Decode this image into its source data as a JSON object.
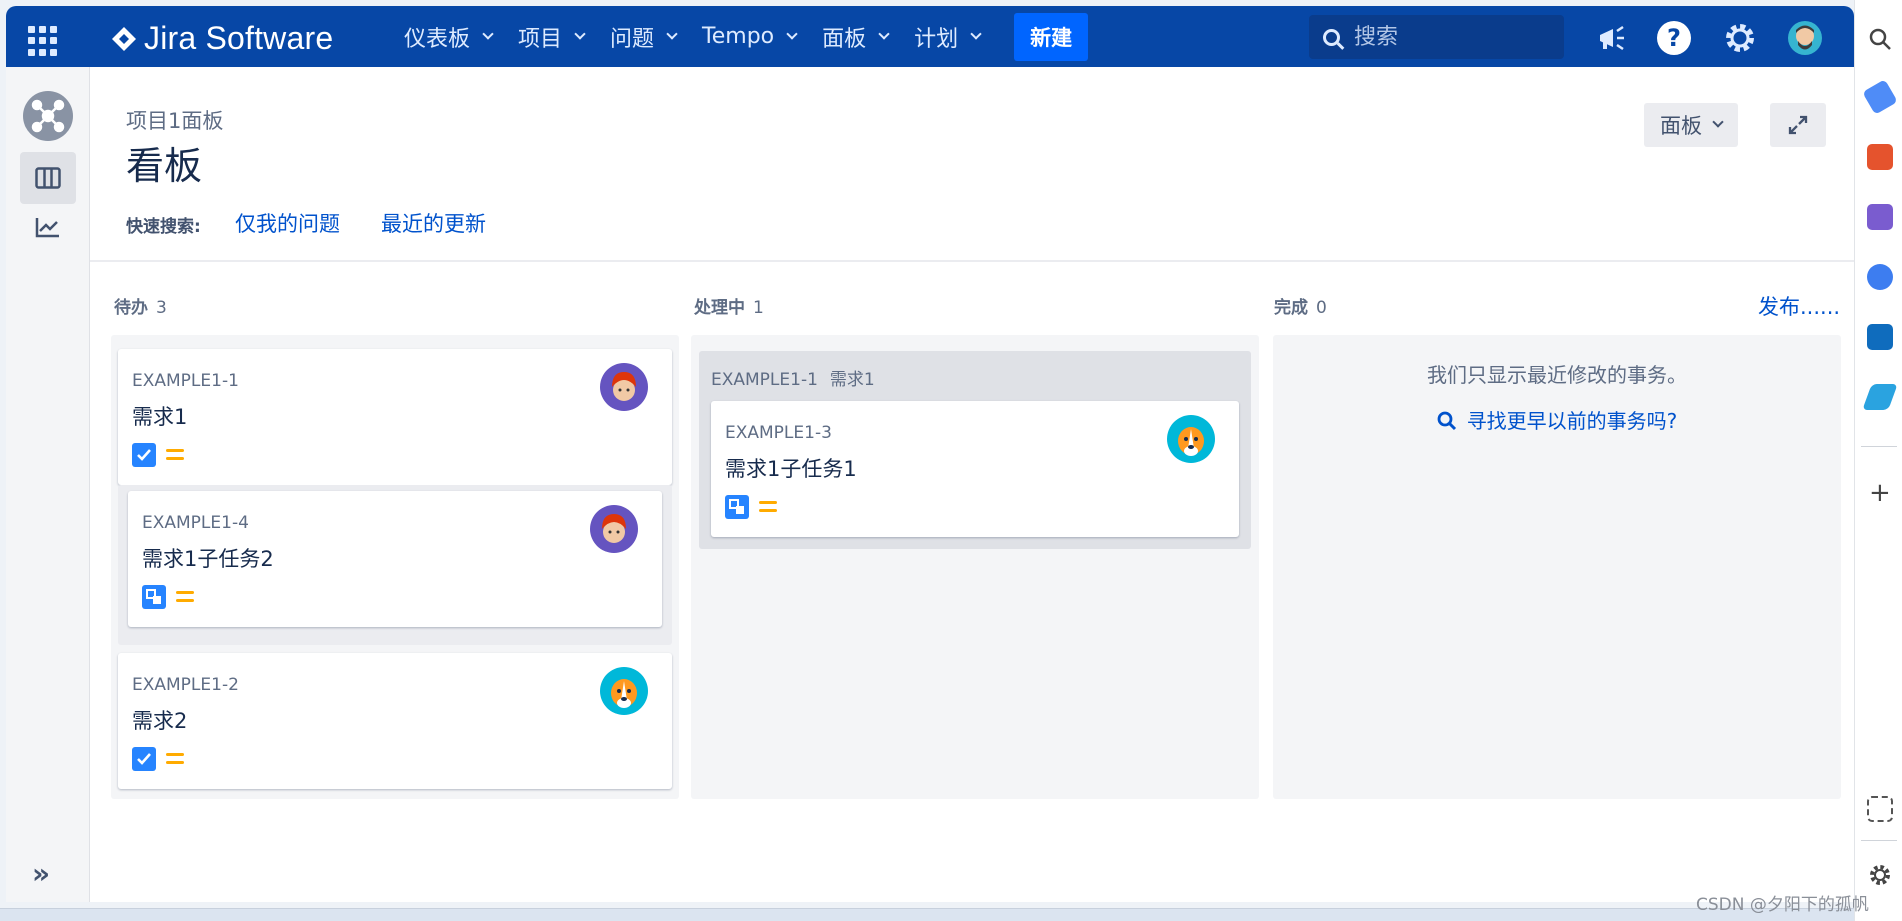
{
  "topnav": {
    "product_name": "Jira Software",
    "menu": [
      "仪表板",
      "项目",
      "问题",
      "Tempo",
      "面板",
      "计划"
    ],
    "create_label": "新建",
    "search_placeholder": "搜索",
    "help_label": "?"
  },
  "page": {
    "breadcrumb": "项目1面板",
    "title": "看板",
    "board_select_label": "面板",
    "quick_filters_label": "快速搜索:",
    "quick_filters": [
      "仅我的问题",
      "最近的更新"
    ]
  },
  "columns": [
    {
      "name": "待办",
      "count": "3"
    },
    {
      "name": "处理中",
      "count": "1"
    },
    {
      "name": "完成",
      "count": "0"
    }
  ],
  "release_label": "发布......",
  "todo_cards": {
    "card1": {
      "key": "EXAMPLE1-1",
      "summary": "需求1",
      "type": "story",
      "priority": "medium"
    },
    "card2": {
      "key": "EXAMPLE1-4",
      "summary": "需求1子任务2",
      "type": "subtask",
      "priority": "medium"
    },
    "card3": {
      "key": "EXAMPLE1-2",
      "summary": "需求2",
      "type": "story",
      "priority": "medium"
    }
  },
  "inprogress": {
    "parent_key": "EXAMPLE1-1",
    "parent_summary": "需求1",
    "card": {
      "key": "EXAMPLE1-3",
      "summary": "需求1子任务1",
      "type": "subtask",
      "priority": "medium"
    }
  },
  "done": {
    "empty_note": "我们只显示最近修改的事务。",
    "find_older": "寻找更早以前的事务吗?"
  },
  "watermark": "CSDN @夕阳下的孤帆",
  "colors": {
    "nav_bg": "#0747a6",
    "link": "#0052cc",
    "priority_medium": "#ffab00",
    "issue_blue": "#2684ff"
  },
  "icons": [
    "app-switcher-icon",
    "jira-logo-icon",
    "search-icon",
    "megaphone-icon",
    "help-icon",
    "gear-icon",
    "user-avatar",
    "board-icon",
    "reports-icon",
    "expand-icon",
    "fullscreen-icon"
  ]
}
